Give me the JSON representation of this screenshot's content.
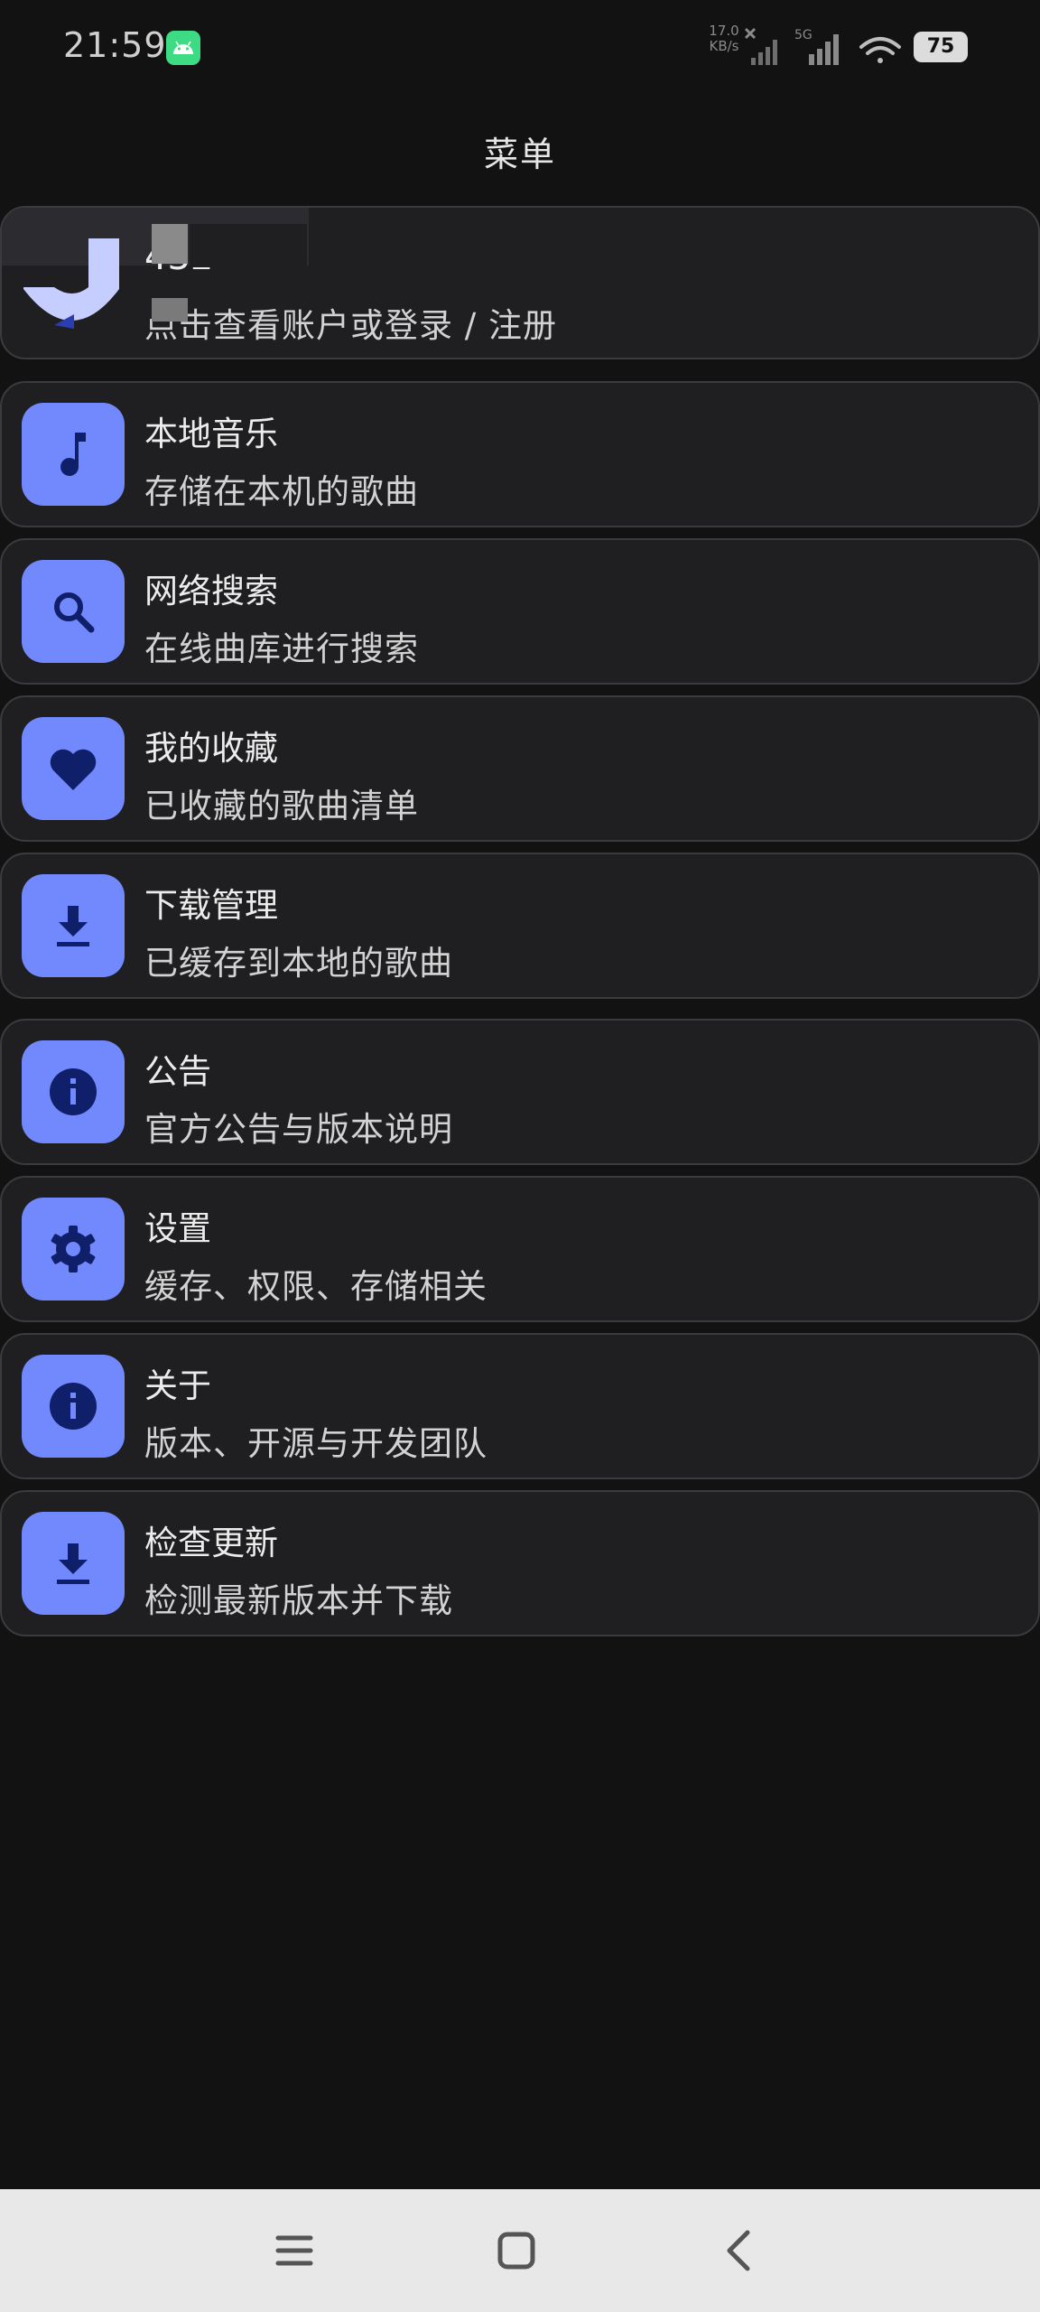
{
  "status_bar": {
    "time": "21:59",
    "net_speed_value": "17.0",
    "net_speed_unit": "KB/s",
    "network_type": "5G",
    "battery": "75",
    "icons": [
      "android-icon",
      "signal-icon",
      "signal-5g-icon",
      "wifi-icon",
      "battery-icon"
    ]
  },
  "header": {
    "title": "菜单"
  },
  "account": {
    "name": "432",
    "subtitle": "点击查看账户或登录 / 注册"
  },
  "menu": {
    "items": [
      {
        "title": "本地音乐",
        "subtitle": "存储在本机的歌曲",
        "icon": "music-note-icon"
      },
      {
        "title": "网络搜索",
        "subtitle": "在线曲库进行搜索",
        "icon": "search-icon"
      },
      {
        "title": "我的收藏",
        "subtitle": "已收藏的歌曲清单",
        "icon": "heart-icon"
      },
      {
        "title": "下载管理",
        "subtitle": "已缓存到本地的歌曲",
        "icon": "download-icon"
      },
      {
        "title": "公告",
        "subtitle": "官方公告与版本说明",
        "icon": "info-icon"
      },
      {
        "title": "设置",
        "subtitle": "缓存、权限、存储相关",
        "icon": "gear-icon"
      },
      {
        "title": "关于",
        "subtitle": "版本、开源与开发团队",
        "icon": "info-icon"
      },
      {
        "title": "检查更新",
        "subtitle": "检测最新版本并下载",
        "icon": "download-icon"
      }
    ]
  },
  "nav_bar": {
    "buttons": [
      "menu-icon",
      "home-icon",
      "back-icon"
    ]
  },
  "colors": {
    "background": "#121212",
    "card": "#1f1f21",
    "card_border": "#3b3b3f",
    "accent": "#7289fd",
    "icon_glyph": "#0f1f6a"
  }
}
